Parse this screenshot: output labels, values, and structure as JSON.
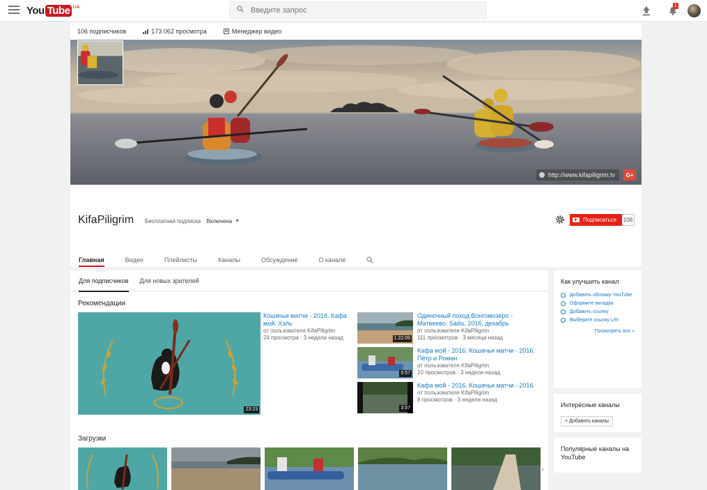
{
  "masthead": {
    "logo_you": "You",
    "logo_tube": "Tube",
    "logo_sup": "UA",
    "search_placeholder": "Введите запрос",
    "notification_count": "1"
  },
  "channel": {
    "stats": [
      "106 подписчиков",
      "173 062 просмотра",
      "Менеджер видео"
    ],
    "name": "KifaPiligrim",
    "subscription_label": "Бесплатная подписка",
    "subscription_value": "Включена",
    "site_link": "http://www.kifapiligrim.tv",
    "gplus_label": "G+",
    "subscribe_label": "Подписаться",
    "subscribe_count": "106",
    "tabs": [
      "Главная",
      "Видео",
      "Плейлисты",
      "Каналы",
      "Обсуждение",
      "О канале"
    ],
    "active_tab": 0
  },
  "feed": {
    "subtabs": [
      "Для подписчиков",
      "Для новых зрителей"
    ],
    "recommend_title": "Рекомендации",
    "featured": {
      "title": "Кошачьи матчи - 2016. Кафа мой. Хэль",
      "author": "от пользователя KifaPiligrim",
      "meta": "24 просмотра · 3 недели назад",
      "duration": "23:23"
    },
    "side_videos": [
      {
        "title": "Одиночный поход Вонгомозеро - Матвеево. Sailis, 2016, декабрь",
        "author": "от пользователя KifaPiligrim",
        "meta": "111 просмотров · 3 месяца назад",
        "duration": "1:22:09"
      },
      {
        "title": "Кафа мой - 2016. Кошачьи матчи - 2016. Пётр и Роман",
        "author": "от пользователя KifaPiligrim",
        "meta": "10 просмотров · 3 недели назад",
        "duration": "5:57"
      },
      {
        "title": "Кафа мой - 2016. Кошачьи матчи - 2016.",
        "author": "от пользователя KifaPiligrim",
        "meta": "8 просмотров · 3 недели назад",
        "duration": "3:57"
      }
    ],
    "uploads_title": "Загрузки"
  },
  "sidebar": {
    "improve_title": "Как улучшить канал",
    "improve_items": [
      "Добавить обложку YouTube",
      "Оформите вкладки",
      "Добавить ссылку",
      "Выберите ссылку LRI"
    ],
    "improve_more": "Посмотреть все »",
    "interesting_title": "Интересные каналы",
    "add_channels": "+ Добавить каналы",
    "popular_title": "Популярные каналы на YouTube"
  }
}
